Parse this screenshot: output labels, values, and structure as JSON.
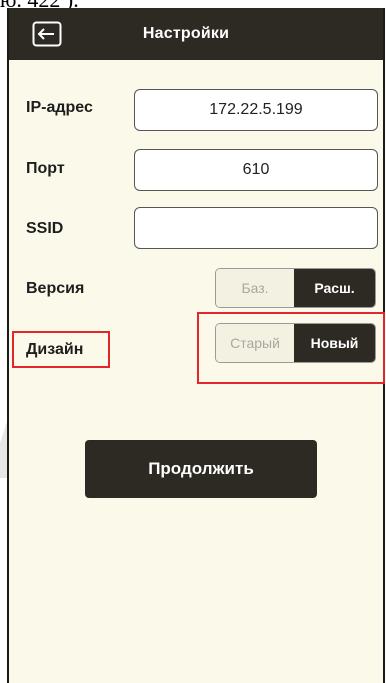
{
  "document": {
    "caption_fragment": "ю. 422 )."
  },
  "header": {
    "back_icon": "back-arrow-icon",
    "title": "Настройки"
  },
  "form": {
    "ip": {
      "label": "IP-адрес",
      "value": "172.22.5.199"
    },
    "port": {
      "label": "Порт",
      "value": "610"
    },
    "ssid": {
      "label": "SSID",
      "value": ""
    },
    "version": {
      "label": "Версия",
      "options": [
        "Баз.",
        "Расш."
      ],
      "selected": "Расш."
    },
    "design": {
      "label": "Дизайн",
      "options": [
        "Старый",
        "Новый"
      ],
      "selected": "Новый"
    }
  },
  "actions": {
    "continue_label": "Продолжить"
  },
  "colors": {
    "bar": "#2c2a22",
    "screen_bg": "#fbfaea",
    "highlight": "#e3262b"
  }
}
